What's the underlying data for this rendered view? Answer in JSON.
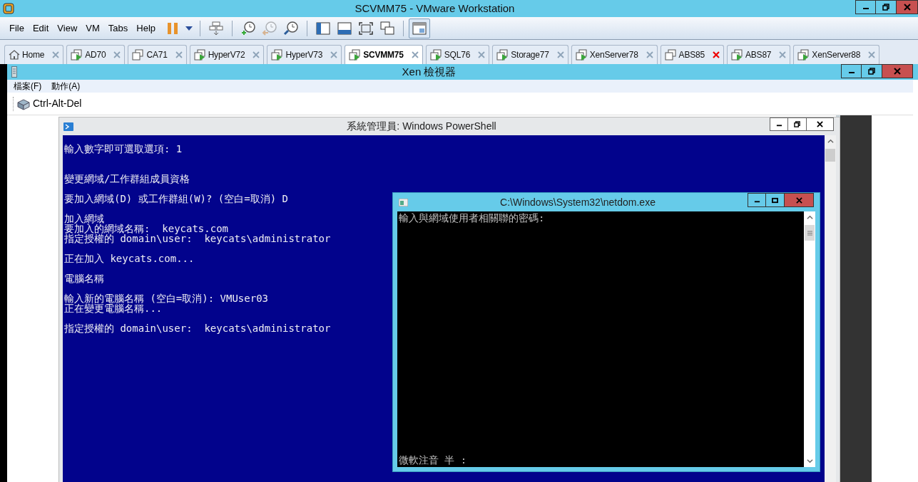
{
  "window": {
    "title": "SCVMM75 - VMware Workstation"
  },
  "menus": [
    "File",
    "Edit",
    "View",
    "VM",
    "Tabs",
    "Help"
  ],
  "toolbar": [
    {
      "kind": "pause",
      "disabled": false,
      "pressed": false
    },
    {
      "kind": "caret",
      "disabled": false,
      "pressed": false
    },
    {
      "kind": "sep"
    },
    {
      "kind": "send-keys",
      "disabled": false,
      "pressed": false
    },
    {
      "kind": "sep"
    },
    {
      "kind": "snapshot-take",
      "disabled": false,
      "pressed": false
    },
    {
      "kind": "snapshot-revert",
      "disabled": true,
      "pressed": false
    },
    {
      "kind": "snapshot-manage",
      "disabled": false,
      "pressed": false
    },
    {
      "kind": "sep"
    },
    {
      "kind": "sidebar",
      "disabled": false,
      "pressed": false
    },
    {
      "kind": "thumbnails",
      "disabled": false,
      "pressed": false
    },
    {
      "kind": "fullscreen",
      "disabled": false,
      "pressed": false
    },
    {
      "kind": "unity",
      "disabled": false,
      "pressed": false
    },
    {
      "kind": "sep"
    },
    {
      "kind": "console",
      "disabled": false,
      "pressed": true
    }
  ],
  "tabs": [
    {
      "label": "Home",
      "kind": "home",
      "selected": false,
      "close_hovered": false
    },
    {
      "label": "AD70",
      "kind": "vm",
      "running": true,
      "selected": false,
      "close_hovered": false
    },
    {
      "label": "CA71",
      "kind": "vm",
      "running": false,
      "selected": false,
      "close_hovered": false
    },
    {
      "label": "HyperV72",
      "kind": "vm",
      "running": true,
      "selected": false,
      "close_hovered": false
    },
    {
      "label": "HyperV73",
      "kind": "vm",
      "running": true,
      "selected": false,
      "close_hovered": false
    },
    {
      "label": "SCVMM75",
      "kind": "vm",
      "running": true,
      "selected": true,
      "close_hovered": false
    },
    {
      "label": "SQL76",
      "kind": "vm",
      "running": true,
      "selected": false,
      "close_hovered": false
    },
    {
      "label": "Storage77",
      "kind": "vm",
      "running": true,
      "selected": false,
      "close_hovered": false
    },
    {
      "label": "XenServer78",
      "kind": "vm",
      "running": true,
      "selected": false,
      "close_hovered": false
    },
    {
      "label": "ABS85",
      "kind": "vm",
      "running": false,
      "selected": false,
      "close_hovered": true
    },
    {
      "label": "ABS87",
      "kind": "vm",
      "running": true,
      "selected": false,
      "close_hovered": false
    },
    {
      "label": "XenServer88",
      "kind": "vm",
      "running": true,
      "selected": false,
      "close_hovered": false
    }
  ],
  "xen_viewer": {
    "title": "Xen 檢視器",
    "menus": [
      "檔案(F)",
      "動作(A)"
    ],
    "toolbar_button": "Ctrl-Alt-Del"
  },
  "powershell": {
    "title": "系統管理員: Windows PowerShell",
    "paragraphs": [
      [
        "輸入數字即可選取選項: 1"
      ],
      [
        "變更網域/工作群組成員資格"
      ],
      [
        "要加入網域(D) 或工作群組(W)? (空白=取消) D"
      ],
      [
        "加入網域",
        "要加入的網域名稱:  keycats.com",
        "指定授權的 domain\\user:  keycats\\administrator"
      ],
      [
        "正在加入 keycats.com..."
      ],
      [
        "電腦名稱"
      ],
      [
        "輸入新的電腦名稱 (空白=取消): VMUser03",
        "正在變更電腦名稱..."
      ],
      [
        "指定授權的 domain\\user:  keycats\\administrator"
      ]
    ]
  },
  "netdom": {
    "title": "C:\\Windows\\System32\\netdom.exe",
    "lines": [
      "輸入與網域使用者相關聯的密碼:"
    ],
    "ime_status": "微軟注音 半 :"
  }
}
